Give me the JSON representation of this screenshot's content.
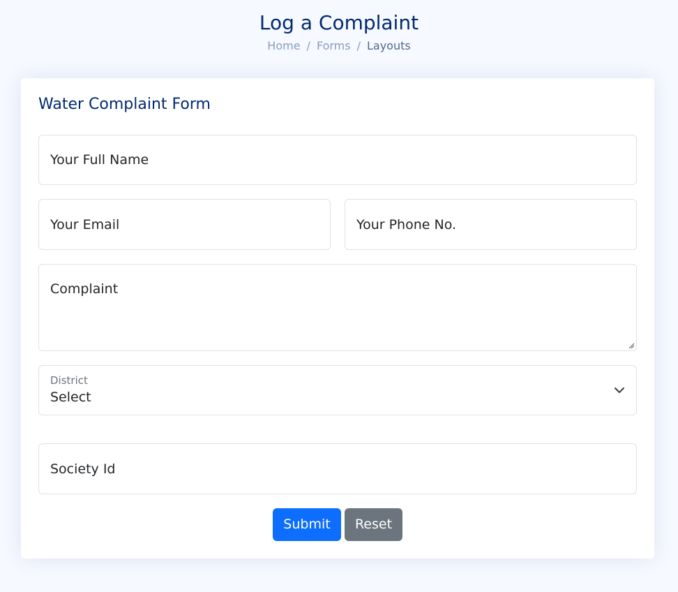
{
  "page": {
    "title": "Log a Complaint",
    "breadcrumb": [
      "Home",
      "Forms",
      "Layouts"
    ],
    "breadcrumb_separator": "/"
  },
  "form": {
    "title": "Water Complaint Form",
    "fields": {
      "full_name": {
        "placeholder": "Your Full Name",
        "value": ""
      },
      "email": {
        "placeholder": "Your Email",
        "value": ""
      },
      "phone": {
        "placeholder": "Your Phone No.",
        "value": ""
      },
      "complaint": {
        "placeholder": "Complaint",
        "value": ""
      },
      "district": {
        "label": "District",
        "selected": "Select"
      },
      "society_id": {
        "placeholder": "Society Id",
        "value": ""
      }
    },
    "buttons": {
      "submit": "Submit",
      "reset": "Reset"
    }
  },
  "colors": {
    "page_background": "#f6f9ff",
    "title": "#012970",
    "primary": "#0d6efd",
    "secondary": "#6c757d"
  },
  "icons": {
    "select_arrow": "chevron-down-icon",
    "textarea_resize": "resize-grip-icon"
  }
}
